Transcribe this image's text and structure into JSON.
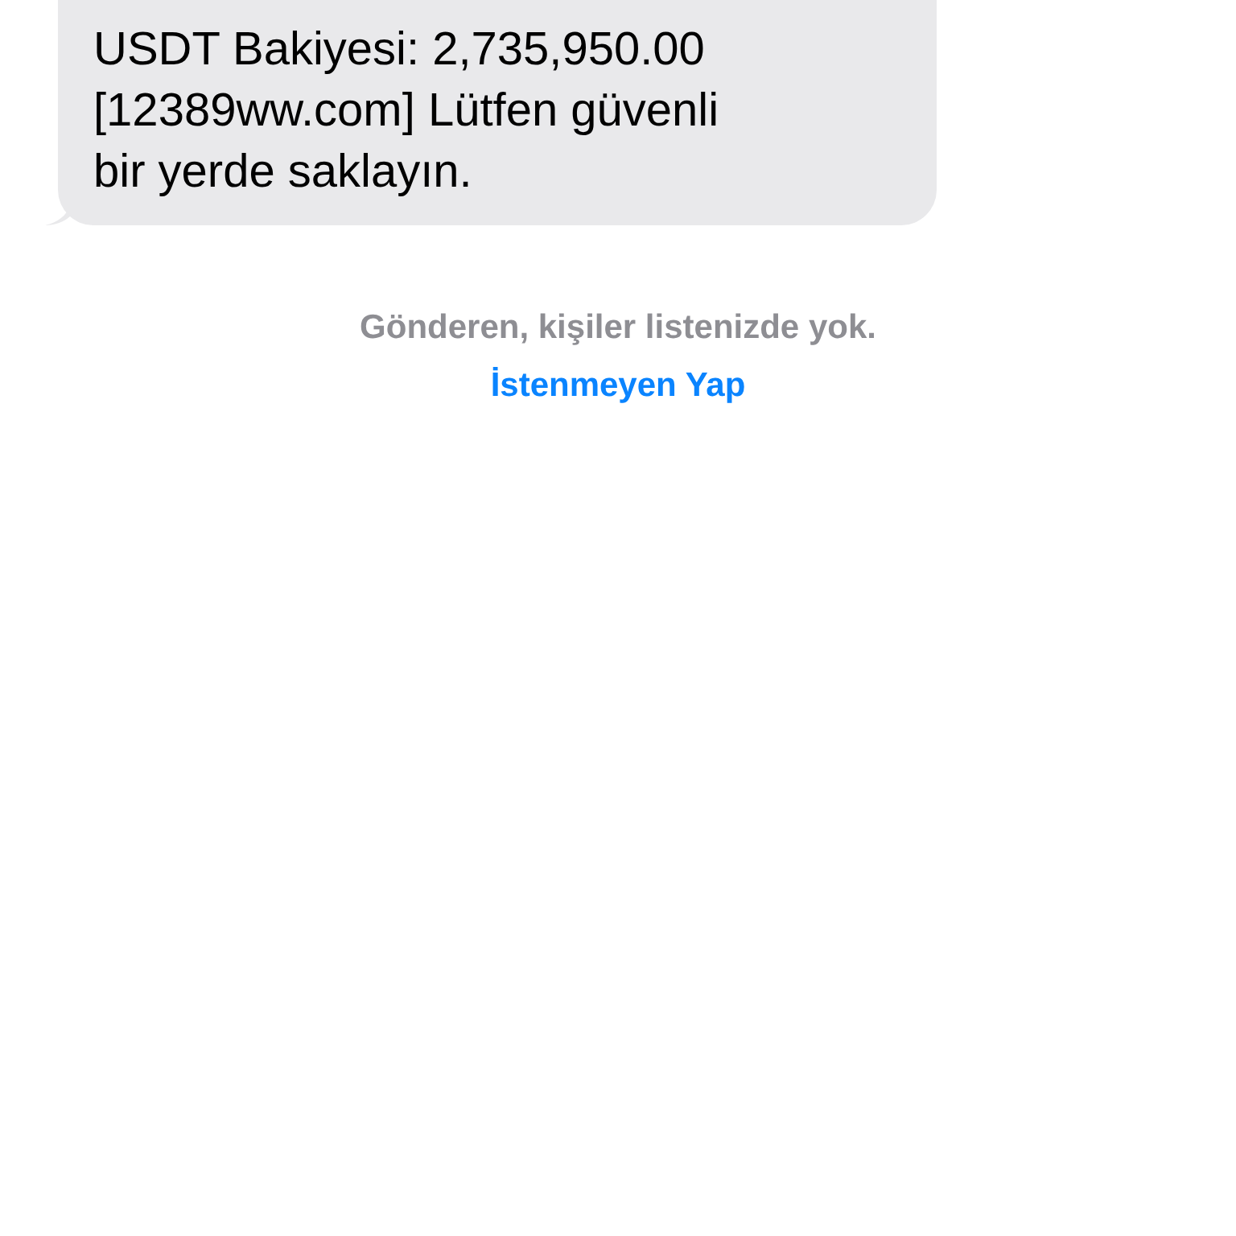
{
  "message": {
    "lines": [
      "USDT Bakiyesi: 2,735,950.00",
      "[12389ww.com] Lütfen güvenli",
      "bir yerde saklayın."
    ]
  },
  "sender_notice": "Gönderen, kişiler listenizde yok.",
  "report_link": "İstenmeyen Yap"
}
